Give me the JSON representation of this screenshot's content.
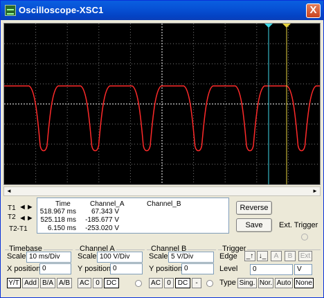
{
  "window": {
    "title": "Oscilloscope-XSC1",
    "close_glyph": "X"
  },
  "readout": {
    "headers": {
      "time": "Time",
      "chA": "Channel_A",
      "chB": "Channel_B"
    },
    "rows": [
      {
        "label": "T1",
        "time": "518.967 ms",
        "chA": "67.343 V",
        "chB": ""
      },
      {
        "label": "T2",
        "time": "525.118 ms",
        "chA": "-185.677 V",
        "chB": ""
      },
      {
        "label": "T2-T1",
        "time": "6.150 ms",
        "chA": "-253.020 V",
        "chB": ""
      }
    ]
  },
  "buttons": {
    "reverse": "Reverse",
    "save": "Save",
    "ext_trigger": "Ext. Trigger"
  },
  "timebase": {
    "title": "Timebase",
    "scale_label": "Scale",
    "scale_value": "10 ms/Div",
    "xpos_label": "X position",
    "xpos_value": "0",
    "modes": [
      "Y/T",
      "Add",
      "B/A",
      "A/B"
    ]
  },
  "channel_a": {
    "title": "Channel A",
    "scale_label": "Scale",
    "scale_value": "100  V/Div",
    "ypos_label": "Y position",
    "ypos_value": "0",
    "couplings": [
      "AC",
      "0",
      "DC"
    ]
  },
  "channel_b": {
    "title": "Channel B",
    "scale_label": "Scale",
    "scale_value": "5  V/Div",
    "ypos_label": "Y position",
    "ypos_value": "0",
    "couplings": [
      "AC",
      "0",
      "DC",
      "-"
    ]
  },
  "trigger": {
    "title": "Trigger",
    "edge_label": "Edge",
    "edge_buttons": [
      "A",
      "B",
      "Ext"
    ],
    "level_label": "Level",
    "level_value": "0",
    "level_unit": "V",
    "type_label": "Type",
    "types": [
      "Sing.",
      "Nor.",
      "Auto",
      "None"
    ]
  },
  "colors": {
    "trace": "#ff2a2a",
    "cursor1": "#3fd9e8",
    "cursor2": "#e8d43f",
    "screen": "#000000"
  }
}
